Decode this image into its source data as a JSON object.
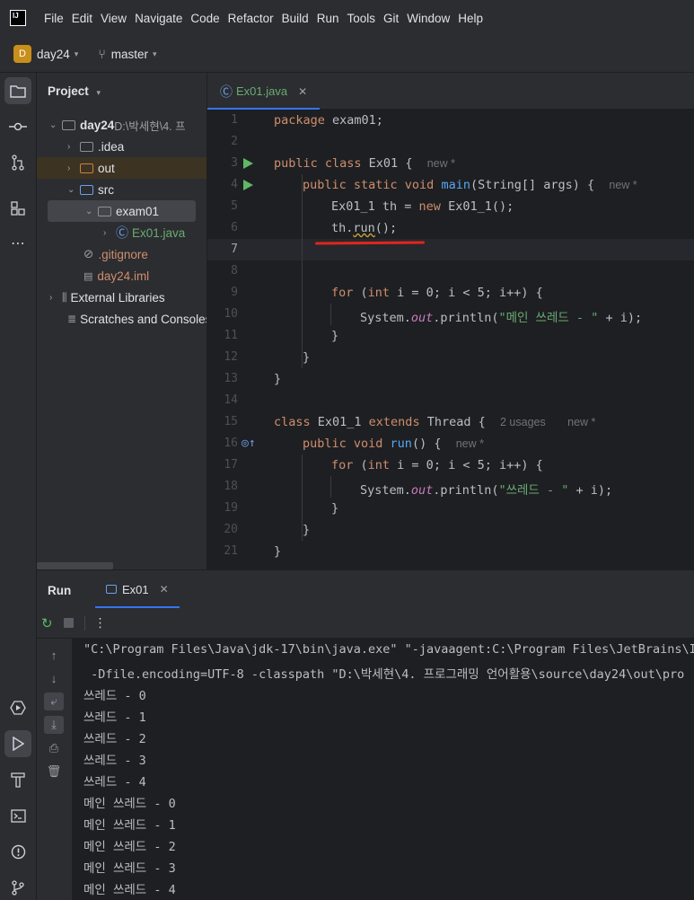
{
  "menu": [
    "File",
    "Edit",
    "View",
    "Navigate",
    "Code",
    "Refactor",
    "Build",
    "Run",
    "Tools",
    "Git",
    "Window",
    "Help"
  ],
  "menu_underline": [
    "F",
    "E",
    "V",
    "N",
    "C",
    "R",
    "B",
    "R",
    "T",
    "G",
    "W",
    "H"
  ],
  "app_logo": "IJ",
  "toolbar": {
    "project_badge": "D",
    "project_name": "day24",
    "branch": "master"
  },
  "project_panel": {
    "header": "Project",
    "tree": [
      {
        "label": "day24",
        "path": " D:\\박세현\\4. 프",
        "bold": true
      },
      {
        "label": ".idea"
      },
      {
        "label": "out"
      },
      {
        "label": "src"
      },
      {
        "label": "exam01"
      },
      {
        "label": "Ex01.java"
      },
      {
        "label": ".gitignore"
      },
      {
        "label": "day24.iml"
      },
      {
        "label": "External Libraries"
      },
      {
        "label": "Scratches and Consoles"
      }
    ]
  },
  "editor": {
    "tab_label": "Ex01.java",
    "line_numbers": [
      "1",
      "2",
      "3",
      "4",
      "5",
      "6",
      "7",
      "8",
      "9",
      "10",
      "11",
      "12",
      "13",
      "14",
      "15",
      "16",
      "17",
      "18",
      "19",
      "20",
      "21"
    ],
    "hints": {
      "new": "new *",
      "usages": "2 usages"
    },
    "code": {
      "l1_kw": "package",
      "l1_rest": " exam01;",
      "l3_kw": "public class",
      "l3_rest": " Ex01 {",
      "l4_kw": "public static void",
      "l4_fn": "main",
      "l4_rest": "(String[] args) {",
      "l5_a": "Ex01_1 th = ",
      "l5_kw": "new",
      "l5_b": " Ex01_1();",
      "l6_a": "th.",
      "l6_run": "run",
      "l6_b": "();",
      "l9_kw": "for",
      "l9_a": " (",
      "l9_int": "int",
      "l9_b": " i = 0; i < 5; i++) {",
      "l10_a": "System.",
      "l10_out": "out",
      "l10_b": ".println(",
      "l10_str": "\"메인 쓰레드 - \"",
      "l10_c": " + i);",
      "l11": "}",
      "l12": "}",
      "l13": "}",
      "l15_kw": "class",
      "l15_a": " Ex01_1 ",
      "l15_kw2": "extends",
      "l15_b": " Thread {",
      "l16_kw": "public void",
      "l16_fn": "run",
      "l16_rest": "() {",
      "l17_kw": "for",
      "l17_a": " (",
      "l17_int": "int",
      "l17_b": " i = 0; i < 5; i++) {",
      "l18_a": "System.",
      "l18_out": "out",
      "l18_b": ".println(",
      "l18_str": "\"쓰레드 - \"",
      "l18_c": " + i);",
      "l19": "}",
      "l20": "}",
      "l21": "}"
    }
  },
  "run_panel": {
    "title": "Run",
    "tab_label": "Ex01",
    "console": [
      "\"C:\\Program Files\\Java\\jdk-17\\bin\\java.exe\" \"-javaagent:C:\\Program Files\\JetBrains\\In",
      " -Dfile.encoding=UTF-8 -classpath \"D:\\박세현\\4. 프로그래밍 언어활용\\source\\day24\\out\\pro",
      "쓰레드 - 0",
      "쓰레드 - 1",
      "쓰레드 - 2",
      "쓰레드 - 3",
      "쓰레드 - 4",
      "메인 쓰레드 - 0",
      "메인 쓰레드 - 1",
      "메인 쓰레드 - 2",
      "메인 쓰레드 - 3",
      "메인 쓰레드 - 4"
    ]
  },
  "colors": {
    "accent": "#3574f0",
    "run_green": "#5fb865",
    "annotation_red": "#e0261d"
  }
}
